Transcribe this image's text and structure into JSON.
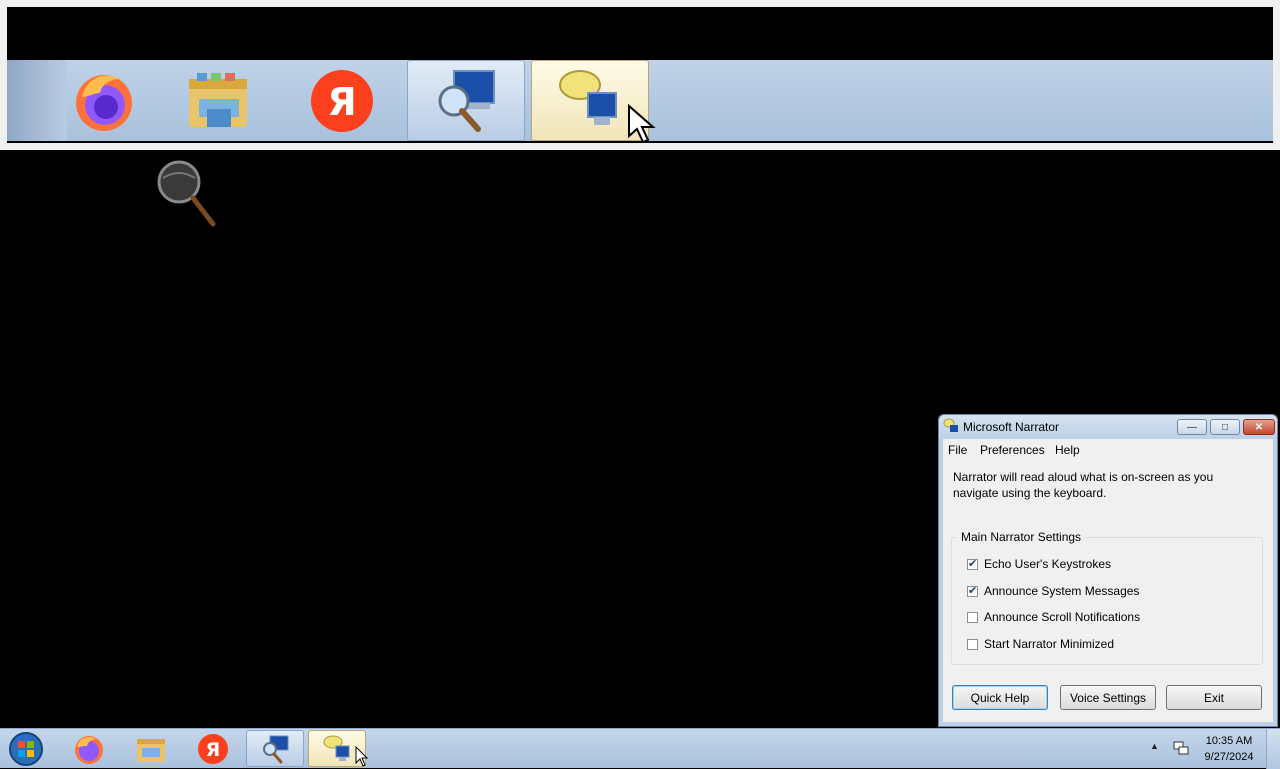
{
  "magnifier": {
    "pinned_apps": [
      {
        "name": "Firefox",
        "icon": "firefox-icon"
      },
      {
        "name": "Windows Explorer",
        "icon": "folder-explorer-icon"
      },
      {
        "name": "Yandex Browser",
        "icon": "yandex-icon",
        "glyph": "Я"
      },
      {
        "name": "Magnifier",
        "icon": "magnifier-app-icon",
        "state": "active"
      },
      {
        "name": "Narrator",
        "icon": "narrator-icon",
        "state": "hot"
      }
    ]
  },
  "narrator": {
    "title": "Microsoft Narrator",
    "menu": [
      "File",
      "Preferences",
      "Help"
    ],
    "description": "Narrator will read aloud what is on-screen as you navigate using the keyboard.",
    "group_title": "Main Narrator Settings",
    "options": [
      {
        "label": "Echo User's Keystrokes",
        "checked": true
      },
      {
        "label": "Announce System Messages",
        "checked": true
      },
      {
        "label": "Announce Scroll Notifications",
        "checked": false
      },
      {
        "label": "Start Narrator Minimized",
        "checked": false
      }
    ],
    "buttons": {
      "quick_help": "Quick Help",
      "voice_settings": "Voice Settings",
      "exit": "Exit"
    }
  },
  "taskbar": {
    "yandex_glyph": "Я",
    "clock": {
      "time": "10:35 AM",
      "date": "9/27/2024"
    }
  },
  "colors": {
    "taskbar": "#a9c0dc",
    "window_frame": "#bcd0e6",
    "firefox_orange": "#ff7139",
    "yandex_red": "#fc3f1d"
  }
}
